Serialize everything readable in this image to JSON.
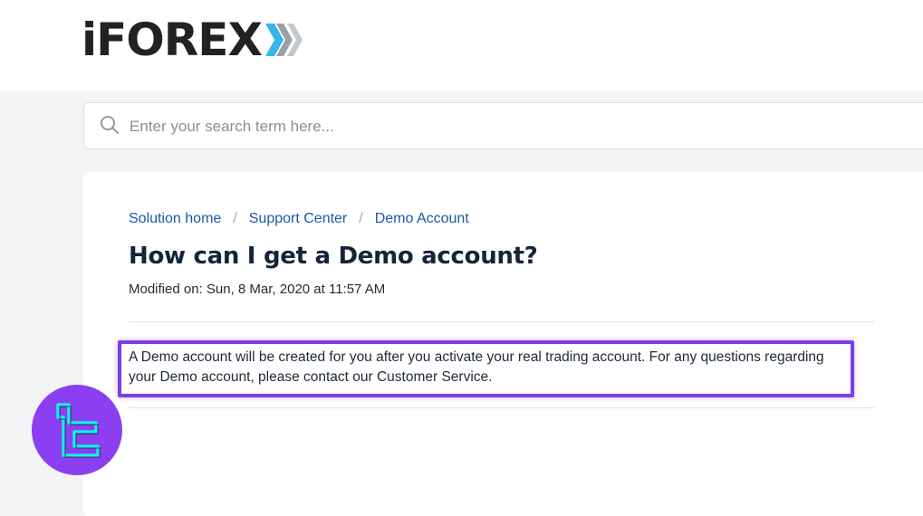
{
  "header": {
    "logo_text": "iFOREX"
  },
  "search": {
    "placeholder": "Enter your search term here..."
  },
  "breadcrumb": {
    "items": [
      "Solution home",
      "Support Center",
      "Demo Account"
    ],
    "separator": "/"
  },
  "article": {
    "title": "How can I get a Demo account?",
    "modified": "Modified on: Sun, 8 Mar, 2020 at 11:57 AM",
    "body": "A Demo account will be created for you after you activate your real trading account. For any questions regarding your Demo account, please contact our Customer Service."
  },
  "colors": {
    "link": "#1c58a8",
    "highlight": "#7b3fe4",
    "watermark": "#8b3ff0",
    "logo_chevron_light": "#38b6e8",
    "logo_chevron_gray": "#9aa0a6"
  }
}
